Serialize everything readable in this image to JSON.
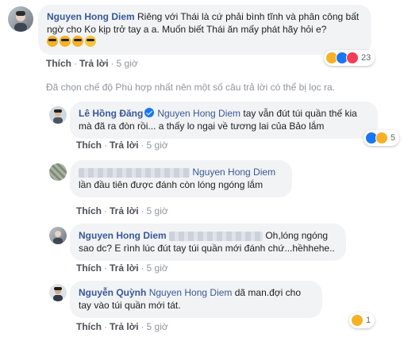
{
  "comments": [
    {
      "author": "Nguyen Hong Diem",
      "text": " Riêng với Thái là cứ phải bình tĩnh và phân công bất ngờ cho Ko kịp trở tay a a. Muốn biết Thái ăn mấy phát hãy hỏi e?",
      "emojis": [
        "sunglasses-emoji",
        "sunglasses-emoji",
        "sunglasses-emoji",
        "laughing-emoji"
      ],
      "like": "Thích",
      "reply": "Trả lời",
      "time": "5 giờ",
      "reaction_count": "23",
      "reaction_icons": [
        "haha",
        "like",
        "love"
      ]
    },
    {
      "author": "Lê Hồng Đăng",
      "mention": "Nguyen Hong Diem",
      "text": " tay vẫn đút túi quần thế kia mà đã ra đòn rồi... a thấy lo ngại về tương lai của Bảo lắm",
      "like": "Thích",
      "reply": "Trả lời",
      "time": "5 giờ",
      "reaction_count": "5",
      "reaction_icons": [
        "like",
        "haha"
      ]
    },
    {
      "author": "",
      "mention": "Nguyen Hong Diem",
      "text": " lần đầu tiên được đánh còn lóng ngóng lắm",
      "like": "Thích",
      "reply": "Trả lời",
      "time": "5 giờ"
    },
    {
      "author": "Nguyen Hong Diem",
      "text": " Oh,lóng ngóng sao dc? E rình lúc đút tay túi quần mới đánh chứ...hềhhehe..",
      "like": "Thích",
      "reply": "Trả lời",
      "time": "5 giờ"
    },
    {
      "author": "Nguyễn Quỳnh",
      "mention": "Nguyen Hong Diem",
      "text": " dã man.đợi cho tay vào túi quần mới tát.",
      "like": "Thích",
      "reply": "Trả lời",
      "time": "5 giờ",
      "reaction_count": "1",
      "reaction_icons": [
        "haha"
      ]
    }
  ],
  "filter_note": "Đã chọn chế độ Phù hợp nhất nên một số câu trả lời có thể bị lọc ra.",
  "colors": {
    "link": "#385898",
    "bubble": "#f2f3f5",
    "meta": "#90949c"
  }
}
